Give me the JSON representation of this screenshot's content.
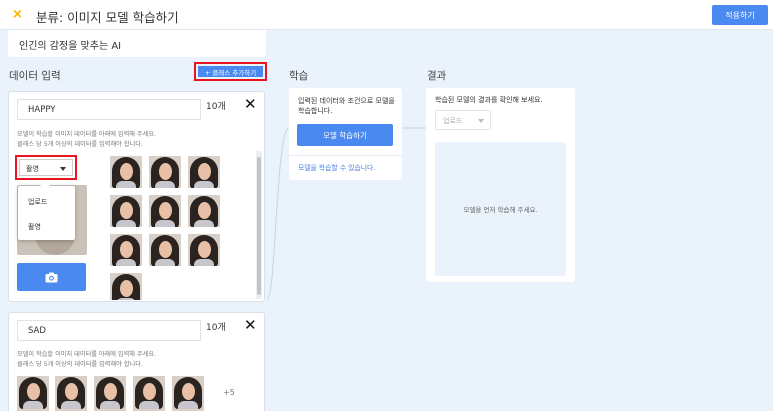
{
  "header": {
    "close_icon": "×",
    "title": "분류: 이미지 모델 학습하기",
    "apply_label": "적용하기"
  },
  "description": "인긴의 감정을 맞추는 AI",
  "data_input": {
    "title": "데이터 입력",
    "add_class_label": "+ 클래스 추가하기"
  },
  "classes": [
    {
      "name": "HAPPY",
      "count": "10개",
      "hint_line1": "모델이 학습할 이미지 데이터를 아래에 입력해 주세요.",
      "hint_line2": "클래스 당 5개 이상의 데이터를 입력해야 합니다.",
      "input_mode": "촬영",
      "dropdown_options": [
        "업로드",
        "촬영"
      ]
    },
    {
      "name": "SAD",
      "count": "10개",
      "hint_line1": "모델이 학습할 이미지 데이터를 아래에 입력해 주세요.",
      "hint_line2": "클래스 당 5개 이상의 데이터를 입력해야 합니다.",
      "more_label": "+5"
    }
  ],
  "training": {
    "title": "학습",
    "description": "입력된 데이터와 조건으로 모델을 학습합니다.",
    "button_label": "모델 학습하기",
    "note": "모델을 학습할 수 있습니다."
  },
  "result": {
    "title": "결과",
    "description": "학습된 모델의 결과를 확인해 보세요.",
    "select_value": "업로드",
    "placeholder": "모델을 먼저 학습해 주세요."
  },
  "colors": {
    "accent": "#4a8af0",
    "highlight": "#e8141f",
    "background": "#eaf2fb"
  }
}
